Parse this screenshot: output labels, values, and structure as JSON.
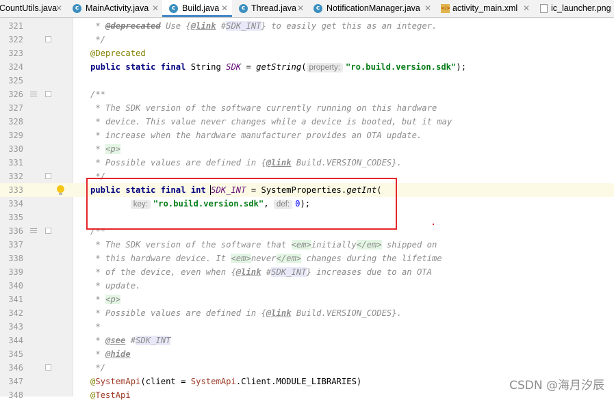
{
  "tabs": [
    {
      "label": "CountUtils.java",
      "icon": "java-class-icon",
      "glyph": "c",
      "active": false
    },
    {
      "label": "MainActivity.java",
      "icon": "java-class-icon",
      "glyph": "c",
      "active": false
    },
    {
      "label": "Build.java",
      "icon": "java-class-icon",
      "glyph": "c",
      "active": true
    },
    {
      "label": "Thread.java",
      "icon": "java-class-icon",
      "glyph": "c",
      "active": false
    },
    {
      "label": "NotificationManager.java",
      "icon": "java-class-icon",
      "glyph": "c",
      "active": false
    },
    {
      "label": "activity_main.xml",
      "icon": "xml-file-icon",
      "glyph": "</>",
      "active": false
    },
    {
      "label": "ic_launcher.png",
      "icon": "image-file-icon",
      "glyph": "",
      "active": false
    }
  ],
  "editor": {
    "current_line": 333,
    "lines": [
      {
        "n": "321"
      },
      {
        "n": "322"
      },
      {
        "n": "323"
      },
      {
        "n": "324"
      },
      {
        "n": "325"
      },
      {
        "n": "326"
      },
      {
        "n": "327"
      },
      {
        "n": "328"
      },
      {
        "n": "329"
      },
      {
        "n": "330"
      },
      {
        "n": "331"
      },
      {
        "n": "332"
      },
      {
        "n": "333"
      },
      {
        "n": "334"
      },
      {
        "n": "335"
      },
      {
        "n": "336"
      },
      {
        "n": "337"
      },
      {
        "n": "338"
      },
      {
        "n": "339"
      },
      {
        "n": "340"
      },
      {
        "n": "341"
      },
      {
        "n": "342"
      },
      {
        "n": "343"
      },
      {
        "n": "344"
      },
      {
        "n": "345"
      },
      {
        "n": "346"
      },
      {
        "n": "347"
      },
      {
        "n": "348"
      }
    ],
    "tokens": {
      "t321a": " * ",
      "t321b": "@deprecated",
      "t321c": " Use {",
      "t321d": "@link",
      "t321e": " #",
      "t321f": "SDK_INT",
      "t321g": "} to easily get this as an integer.",
      "t322": " */",
      "t323": "@Deprecated",
      "t324a": "public static final",
      "t324b": " String ",
      "t324c": "SDK",
      "t324d": " = ",
      "t324e": "getString",
      "t324f": "(",
      "t324g": "property:",
      "t324h": "\"ro.build.version.sdk\"",
      "t324i": ");",
      "t326": "/**",
      "t327": " * The SDK version of the software currently running on this hardware",
      "t328": " * device. This value never changes while a device is booted, but it may",
      "t329": " * increase when the hardware manufacturer provides an OTA update.",
      "t330a": " * ",
      "t330b": "<p>",
      "t331a": " * Possible values are defined in {",
      "t331b": "@link",
      "t331c": " Build.",
      "t331d": "VERSION_CODES",
      "t331e": "}.",
      "t332": " */",
      "t333a": "public static final int ",
      "t333b": "SDK_INT",
      "t333c": " = SystemProperties.",
      "t333d": "getInt",
      "t333e": "(",
      "t334a": "        ",
      "t334b": "key:",
      "t334c": "\"ro.build.version.sdk\"",
      "t334d": ", ",
      "t334e": "def:",
      "t334f": "0",
      "t334g": ");",
      "t336": "/**",
      "t337a": " * The SDK version of the software that ",
      "t337b": "<em>",
      "t337c": "initially",
      "t337d": "</em>",
      "t337e": " shipped on",
      "t338a": " * this hardware device. It ",
      "t338b": "<em>",
      "t338c": "never",
      "t338d": "</em>",
      "t338e": " changes during the lifetime",
      "t339a": " * of the device, even when {",
      "t339b": "@link",
      "t339c": " #",
      "t339d": "SDK_INT",
      "t339e": "} increases due to an OTA",
      "t340": " * update.",
      "t341a": " * ",
      "t341b": "<p>",
      "t342a": " * Possible values are defined in {",
      "t342b": "@link",
      "t342c": " Build.",
      "t342d": "VERSION_CODES",
      "t342e": "}.",
      "t343": " *",
      "t344a": " * ",
      "t344b": "@see",
      "t344c": " #",
      "t344d": "SDK_INT",
      "t345a": " * ",
      "t345b": "@hide",
      "t346": " */",
      "t347a": "@",
      "t347b": "SystemApi",
      "t347c": "(client = ",
      "t347d": "SystemApi",
      "t347e": ".Client.MODULE_LIBRARIES)",
      "t348a": "@",
      "t348b": "TestApi"
    }
  },
  "watermark": "CSDN @海月汐辰",
  "colors": {
    "highlight_box": "#e5262a",
    "current_line_bg": "#fcfae5",
    "tab_underline": "#4a88c7"
  }
}
